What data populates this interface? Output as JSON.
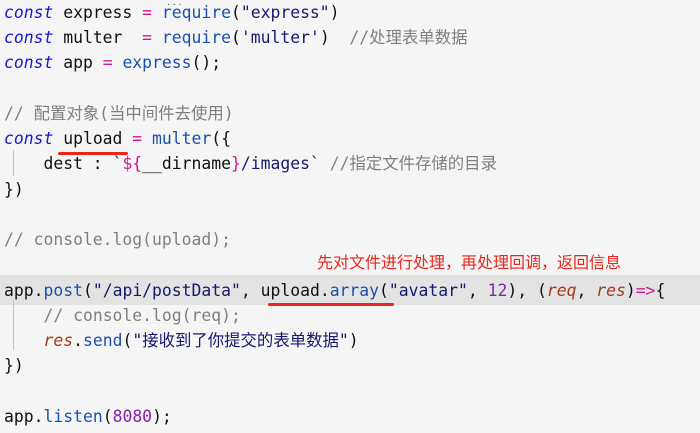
{
  "editor": {
    "lines": [
      [
        [
          "kw",
          "const"
        ],
        [
          "pl",
          " express "
        ],
        [
          "op",
          "="
        ],
        [
          "pl",
          " "
        ],
        [
          "fn",
          "require"
        ],
        [
          "pl",
          "("
        ],
        [
          "str",
          "\"express\""
        ],
        [
          "pl",
          ")"
        ]
      ],
      [
        [
          "kw",
          "const"
        ],
        [
          "pl",
          " multer  "
        ],
        [
          "op",
          "="
        ],
        [
          "pl",
          " "
        ],
        [
          "fn",
          "require"
        ],
        [
          "pl",
          "("
        ],
        [
          "str",
          "'multer'"
        ],
        [
          "pl",
          ")  "
        ],
        [
          "cm",
          "//处理表单数据"
        ]
      ],
      [
        [
          "kw",
          "const"
        ],
        [
          "pl",
          " app "
        ],
        [
          "op",
          "="
        ],
        [
          "pl",
          " "
        ],
        [
          "fn",
          "express"
        ],
        [
          "pl",
          "();"
        ]
      ],
      [],
      [
        [
          "cm",
          "// 配置对象(当中间件去使用)"
        ]
      ],
      [
        [
          "kw",
          "const"
        ],
        [
          "pl",
          " upload "
        ],
        [
          "op",
          "="
        ],
        [
          "pl",
          " "
        ],
        [
          "fn",
          "multer"
        ],
        [
          "pl",
          "({"
        ]
      ],
      [
        [
          "pl",
          "    dest : "
        ],
        [
          "str",
          "`"
        ],
        [
          "op",
          "${"
        ],
        [
          "pl",
          "__dirname"
        ],
        [
          "op",
          "}"
        ],
        [
          "str",
          "/images`"
        ],
        [
          "pl",
          " "
        ],
        [
          "cm",
          "//指定文件存储的目录"
        ]
      ],
      [
        [
          "pl",
          "})"
        ]
      ],
      [],
      [
        [
          "cm",
          "// console.log(upload);"
        ]
      ],
      [],
      [
        [
          "pl",
          "app."
        ],
        [
          "fn",
          "post"
        ],
        [
          "pl",
          "("
        ],
        [
          "str",
          "\"/api/postData\""
        ],
        [
          "pl",
          ", upload."
        ],
        [
          "fn",
          "array"
        ],
        [
          "pl",
          "("
        ],
        [
          "str",
          "\"avatar\""
        ],
        [
          "pl",
          ", "
        ],
        [
          "num",
          "12"
        ],
        [
          "pl",
          "), ("
        ],
        [
          "param",
          "req"
        ],
        [
          "pl",
          ", "
        ],
        [
          "param",
          "res"
        ],
        [
          "pl",
          ")"
        ],
        [
          "op",
          "=>"
        ],
        [
          "pl",
          "{"
        ]
      ],
      [
        [
          "pl",
          "    "
        ],
        [
          "cm",
          "// console.log(req);"
        ]
      ],
      [
        [
          "pl",
          "    "
        ],
        [
          "param",
          "res"
        ],
        [
          "pl",
          "."
        ],
        [
          "fn",
          "send"
        ],
        [
          "pl",
          "("
        ],
        [
          "str",
          "\"接收到了你提交的表单数据\""
        ],
        [
          "pl",
          ")"
        ]
      ],
      [
        [
          "pl",
          "})"
        ]
      ],
      [],
      [
        [
          "pl",
          "app."
        ],
        [
          "fn",
          "listen"
        ],
        [
          "pl",
          "("
        ],
        [
          "num",
          "8080"
        ],
        [
          "pl",
          ");"
        ]
      ]
    ]
  },
  "annotation": {
    "text": "先对文件进行处理，再处理回调，返回信息",
    "color": "#e8261e"
  },
  "colors": {
    "background": "#f5f5f5",
    "keyword": "#1a1ad1",
    "operator": "#d1168c",
    "function": "#1a4fb0",
    "string": "#18186e",
    "comment": "#7f7f7f",
    "number": "#8a1ea8",
    "parameter": "#a53a1e",
    "highlight": "#e3e3e3"
  }
}
